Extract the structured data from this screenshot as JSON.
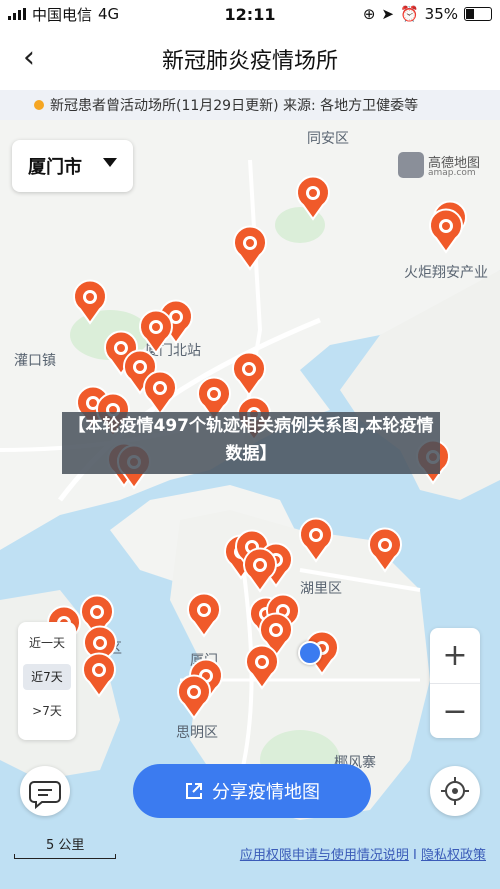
{
  "status_bar": {
    "carrier": "中国电信",
    "network": "4G",
    "time": "12:11",
    "battery": "35%"
  },
  "header": {
    "title": "新冠肺炎疫情场所"
  },
  "notice": {
    "text": "新冠患者曾活动场所(11月29日更新) 来源: 各地方卫健委等"
  },
  "map": {
    "city_selector": "厦门市",
    "logo_name": "高德地图",
    "logo_sub": "amap.com",
    "places": [
      "同安区",
      "火炬翔安产业",
      "灌口镇",
      "厦门北站",
      "湖里区",
      "厦门",
      "思明区",
      "椰风寨",
      "区"
    ],
    "overlay_banner": "【本轮疫情497个轨迹相关病例关系图,本轮疫情数据】",
    "pin_color": "#f05a2a",
    "time_filters": [
      "近一天",
      "近7天",
      ">7天"
    ],
    "active_time_filter": "近7天",
    "zoom_in": "+",
    "zoom_out": "−",
    "share_button": "分享疫情地图",
    "scale_label": "5 公里",
    "links": {
      "permission": "应用权限申请与使用情况说明",
      "separator": "I",
      "privacy": "隐私权政策"
    }
  }
}
